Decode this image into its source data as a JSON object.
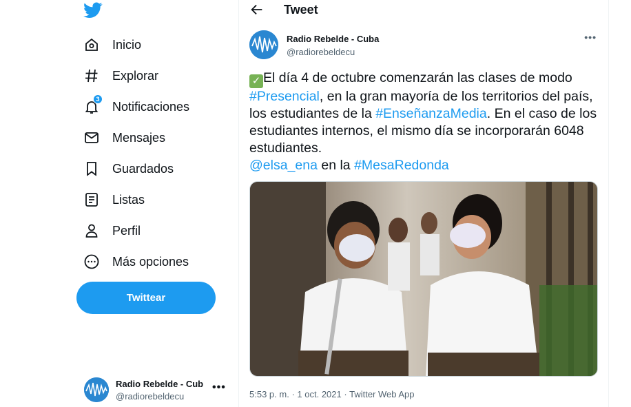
{
  "sidebar": {
    "logo_icon": "twitter-bird-icon",
    "items": [
      {
        "label": "Inicio",
        "icon": "home-icon"
      },
      {
        "label": "Explorar",
        "icon": "hashtag-icon"
      },
      {
        "label": "Notificaciones",
        "icon": "bell-icon",
        "badge": "3"
      },
      {
        "label": "Mensajes",
        "icon": "envelope-icon"
      },
      {
        "label": "Guardados",
        "icon": "bookmark-icon"
      },
      {
        "label": "Listas",
        "icon": "list-icon"
      },
      {
        "label": "Perfil",
        "icon": "person-icon"
      },
      {
        "label": "Más opciones",
        "icon": "more-circle-icon"
      }
    ],
    "tweet_button": "Twittear",
    "account": {
      "name": "Radio Rebelde - Cub",
      "handle": "@radiorebeldecu",
      "more": "•••"
    }
  },
  "header": {
    "title": "Tweet"
  },
  "tweet": {
    "author_name": "Radio Rebelde - Cuba",
    "author_handle": "@radiorebeldecu",
    "more": "•••",
    "text_parts": [
      {
        "t": "El día 4 de octubre comenzarán las clases de modo "
      },
      {
        "t": "#Presencial",
        "link": true
      },
      {
        "t": ", en la gran mayoría de los territorios del país, los estudiantes de la "
      },
      {
        "t": "#EnseñanzaMedia",
        "link": true
      },
      {
        "t": ". En el caso de los estudiantes internos, el mismo día se incorporarán 6048 estudiantes."
      },
      {
        "br": true
      },
      {
        "t": "@elsa_ena",
        "link": true
      },
      {
        "t": " en la "
      },
      {
        "t": "#MesaRedonda",
        "link": true
      }
    ],
    "time": "5:53 p. m.",
    "date": "1 oct. 2021",
    "source": "Twitter Web App",
    "separator": "·"
  },
  "colors": {
    "accent": "#1d9bf0",
    "text": "#0f1419",
    "muted": "#536471"
  }
}
